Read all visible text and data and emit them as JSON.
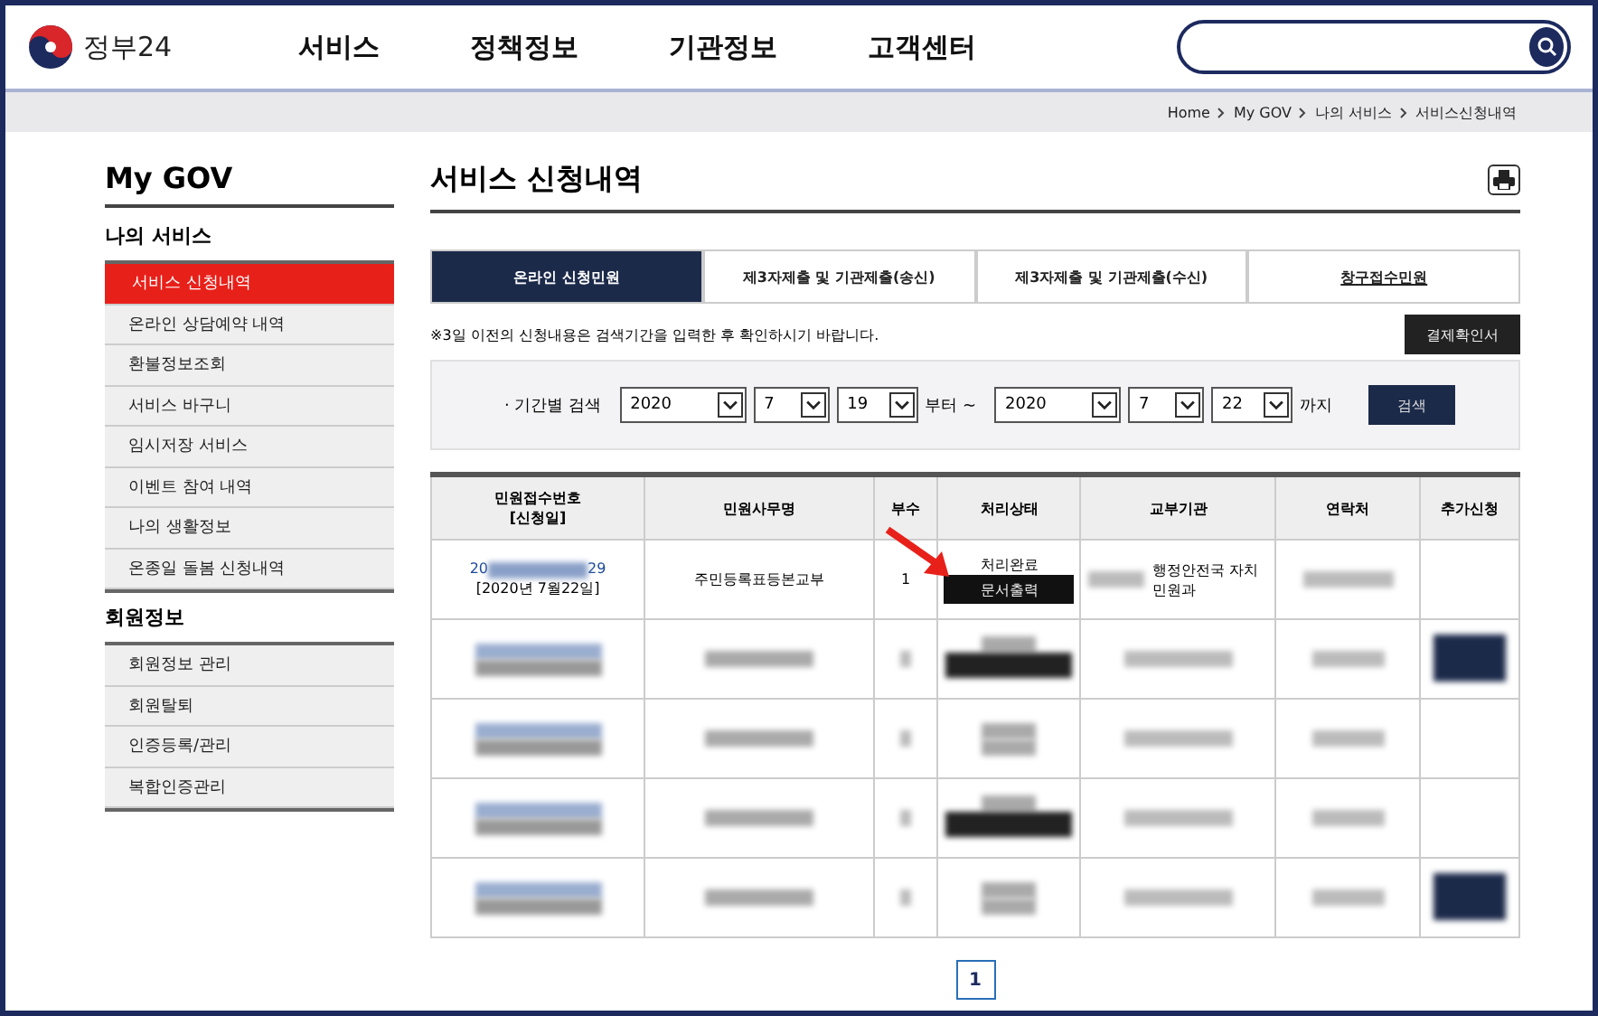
{
  "header": {
    "logo": "정부24",
    "nav": [
      "서비스",
      "정책정보",
      "기관정보",
      "고객센터"
    ]
  },
  "breadcrumb": [
    "Home",
    "My GOV",
    "나의 서비스",
    "서비스신청내역"
  ],
  "sidebar": {
    "title": "My GOV",
    "sections": [
      {
        "title": "나의 서비스",
        "items": [
          {
            "label": "서비스 신청내역",
            "selected": true
          },
          {
            "label": "온라인 상담예약 내역",
            "selected": false
          },
          {
            "label": "환불정보조회",
            "selected": false
          },
          {
            "label": "서비스 바구니",
            "selected": false
          },
          {
            "label": "임시저장 서비스",
            "selected": false
          },
          {
            "label": "이벤트 참여 내역",
            "selected": false
          },
          {
            "label": "나의 생활정보",
            "selected": false
          },
          {
            "label": "온종일 돌봄 신청내역",
            "selected": false
          }
        ]
      },
      {
        "title": "회원정보",
        "items": [
          {
            "label": "회원정보 관리",
            "selected": false
          },
          {
            "label": "회원탈퇴",
            "selected": false
          },
          {
            "label": "인증등록/관리",
            "selected": false
          },
          {
            "label": "복합인증관리",
            "selected": false
          }
        ]
      }
    ]
  },
  "page_title": "서비스 신청내역",
  "tabs": [
    {
      "label": "온라인 신청민원",
      "selected": true
    },
    {
      "label": "제3자제출 및 기관제출(송신)",
      "selected": false
    },
    {
      "label": "제3자제출 및 기관제출(수신)",
      "selected": false
    },
    {
      "label": "창구접수민원",
      "selected": false
    }
  ],
  "notice": "※3일 이전의 신청내용은 검색기간을 입력한 후 확인하시기 바랍니다.",
  "payment_button": "결제확인서",
  "search": {
    "label": "· 기간별 검색",
    "from": [
      "2020",
      "7",
      "19"
    ],
    "from_suffix": "부터 ~",
    "to": [
      "2020",
      "7",
      "22"
    ],
    "to_suffix": "까지",
    "button": "검색"
  },
  "table": {
    "columns": [
      "민원접수번호\n[신청일]",
      "민원사무명",
      "부수",
      "처리상태",
      "교부기관",
      "연락처",
      "추가신청"
    ],
    "first_row": {
      "id_prefix": "20",
      "id_suffix": "29",
      "date": "[2020년 7월22일]",
      "name": "주민등록표등본교부",
      "copies": "1",
      "status": "처리완료",
      "status_button": "문서출력",
      "agency": "행정안전국 자치민원과"
    },
    "redacted_rows": [
      {
        "status_button": true,
        "extra_button": true
      },
      {
        "status_button": false,
        "extra_button": false
      },
      {
        "status_button": true,
        "extra_button": false
      },
      {
        "status_button": false,
        "extra_button": true
      }
    ]
  },
  "pagination": [
    {
      "label": "1",
      "selected": true
    }
  ]
}
